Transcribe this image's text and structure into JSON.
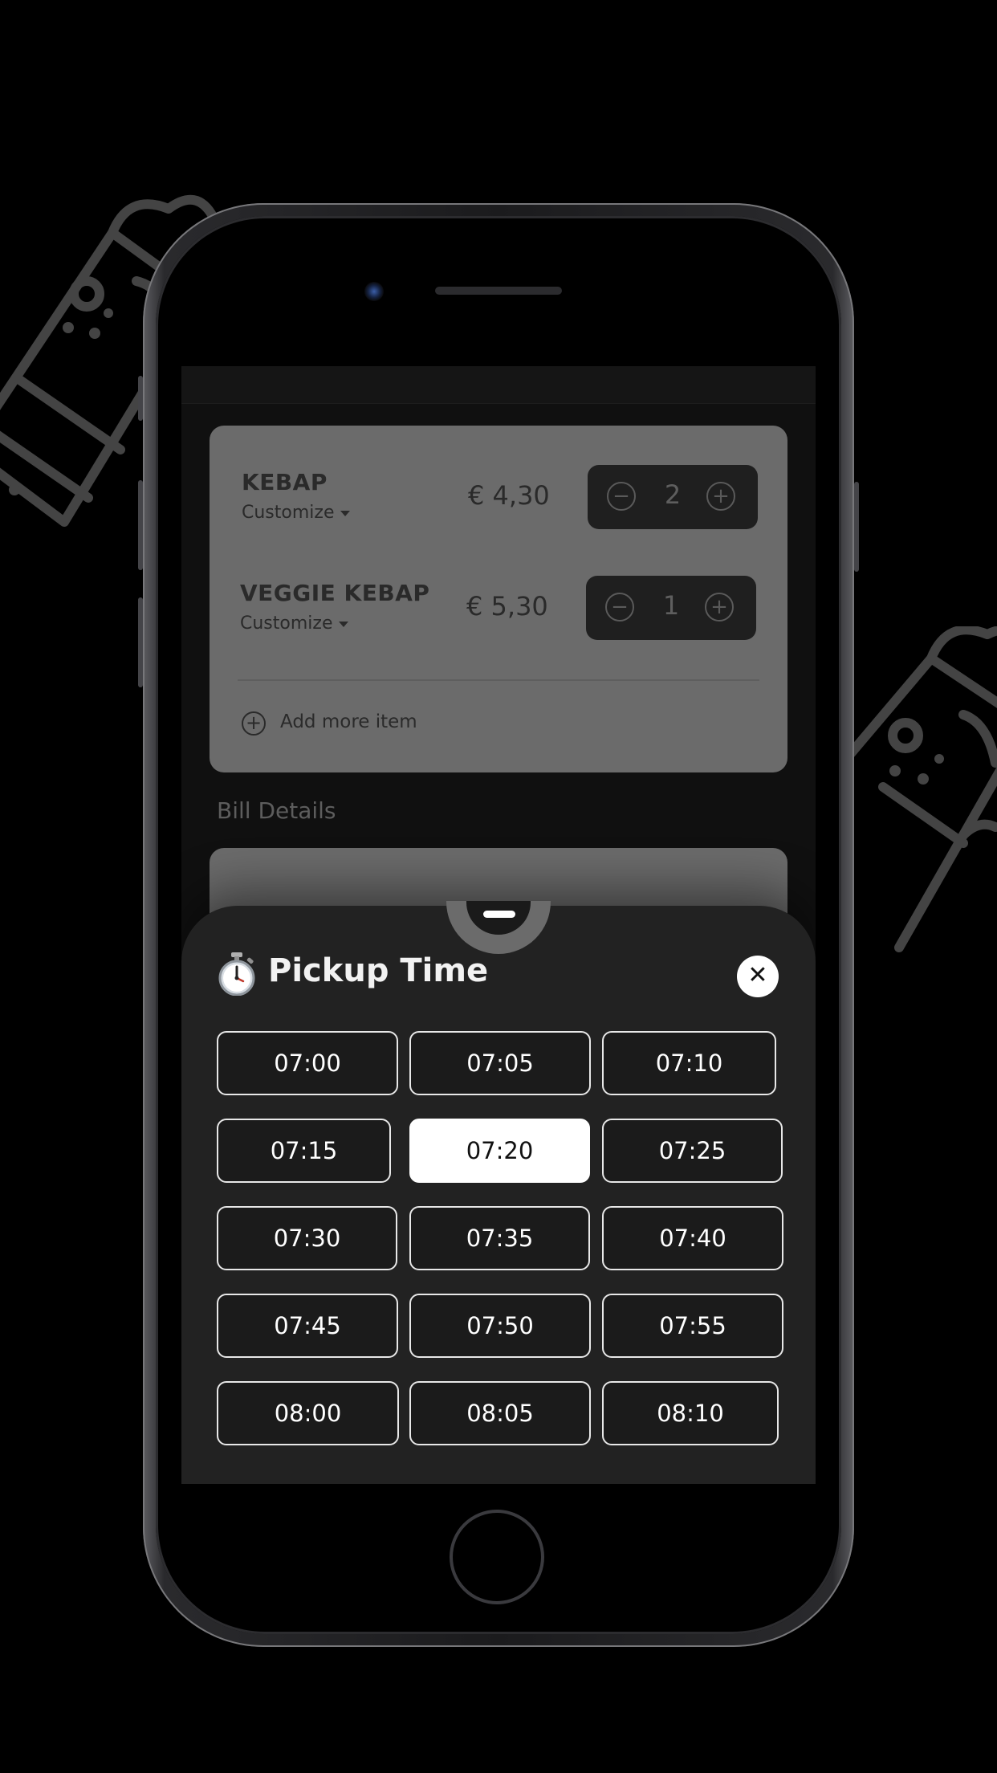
{
  "cart": {
    "items": [
      {
        "name": "KEBAP",
        "customize": "Customize",
        "price": "€ 4,30",
        "qty": "2"
      },
      {
        "name": "VEGGIE KEBAP",
        "customize": "Customize",
        "price": "€ 5,30",
        "qty": "1"
      }
    ],
    "add_more_label": "Add more item",
    "stepper_minus": "−",
    "stepper_plus": "+"
  },
  "bill": {
    "title": "Bill Details"
  },
  "pickup": {
    "title": "Pickup Time",
    "close_glyph": "✕",
    "selected": "07:20",
    "slots": [
      "07:00",
      "07:05",
      "07:10",
      "07:15",
      "07:20",
      "07:25",
      "07:30",
      "07:35",
      "07:40",
      "07:45",
      "07:50",
      "07:55",
      "08:00",
      "08:05",
      "08:10"
    ]
  },
  "colors": {
    "background": "#000000",
    "sheet": "#222222",
    "selected_slot": "#ffffff",
    "card": "#6b6b6b"
  },
  "icons": [
    "stopwatch-icon",
    "close-icon",
    "minus-icon",
    "plus-icon",
    "add-circle-icon",
    "caret-down-icon",
    "kebab-illustration-icon",
    "home-button-icon",
    "camera-icon"
  ]
}
